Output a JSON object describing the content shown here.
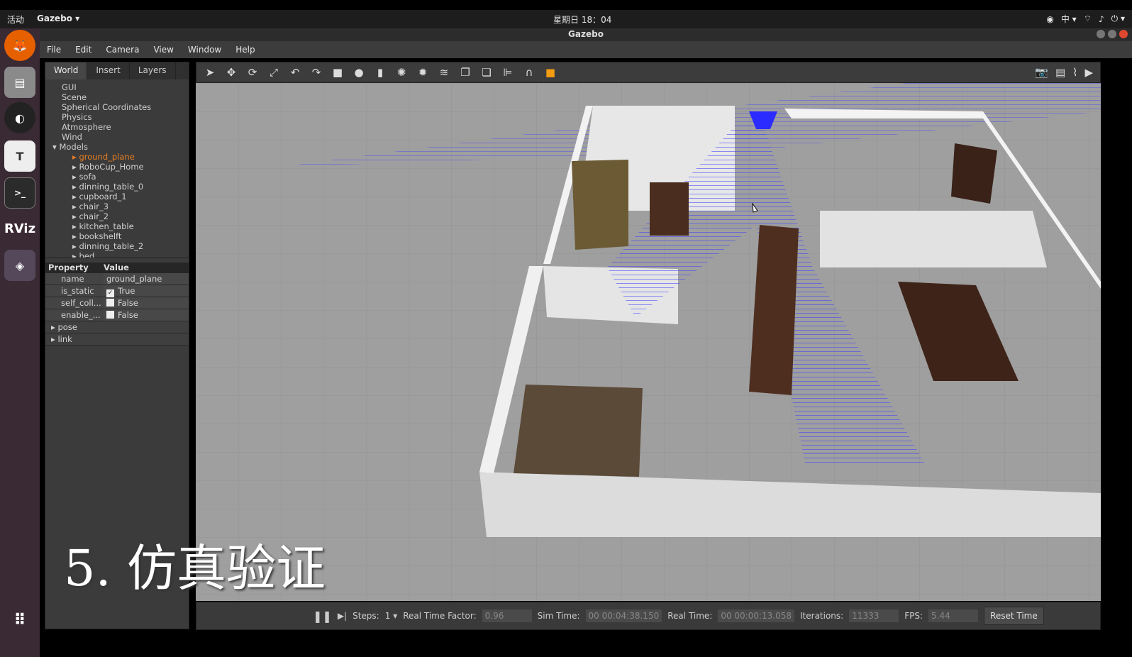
{
  "top_bar": {
    "activities": "活动",
    "app_menu": "Gazebo ▾",
    "clock": "星期日 18：04",
    "input_method": "中 ▾"
  },
  "window": {
    "title": "Gazebo"
  },
  "dock": {
    "apps": [
      "firefox-icon",
      "files-icon",
      "obs-icon",
      "typora-icon",
      "terminal-icon",
      "rviz-icon",
      "gazebo-icon",
      "show-apps-icon"
    ],
    "rviz_label": "RViz",
    "typora_label": "T",
    "terminal_label": ">_"
  },
  "menubar": {
    "items": [
      "File",
      "Edit",
      "Camera",
      "View",
      "Window",
      "Help"
    ]
  },
  "left_panel": {
    "tabs": [
      "World",
      "Insert",
      "Layers"
    ],
    "active_tab": "World",
    "tree": {
      "root_items": [
        "GUI",
        "Scene",
        "Spherical Coordinates",
        "Physics",
        "Atmosphere",
        "Wind"
      ],
      "models_label": "Models",
      "models": [
        "ground_plane",
        "RoboCup_Home",
        "sofa",
        "dinning_table_0",
        "cupboard_1",
        "chair_3",
        "chair_2",
        "kitchen_table",
        "bookshelft",
        "dinning_table_2",
        "bed"
      ],
      "selected_model": "ground_plane"
    },
    "properties": {
      "header_property": "Property",
      "header_value": "Value",
      "rows": [
        {
          "key": "name",
          "value": "ground_plane",
          "checkbox": false
        },
        {
          "key": "is_static",
          "value": "True",
          "checkbox": true,
          "checked": true
        },
        {
          "key": "self_coll...",
          "value": "False",
          "checkbox": true,
          "checked": false
        },
        {
          "key": "enable_...",
          "value": "False",
          "checkbox": true,
          "checked": false
        }
      ],
      "groups": [
        "pose",
        "link"
      ]
    }
  },
  "viewport": {
    "overlay_caption": "5. 仿真验证"
  },
  "statusbar": {
    "steps_label": "Steps:",
    "steps_value": "1 ▾",
    "rtf_label": "Real Time Factor:",
    "rtf_value": "0.96",
    "sim_time_label": "Sim Time:",
    "sim_time_value": "00 00:04:38.150",
    "real_time_label": "Real Time:",
    "real_time_value": "00 00:00:13.058",
    "iterations_label": "Iterations:",
    "iterations_value": "11333",
    "fps_label": "FPS:",
    "fps_value": "5.44",
    "reset_label": "Reset Time"
  },
  "colors": {
    "laser": "#3f3fff",
    "selected_tree_item": "#e67e22",
    "panel_bg": "#3b3b3b"
  }
}
